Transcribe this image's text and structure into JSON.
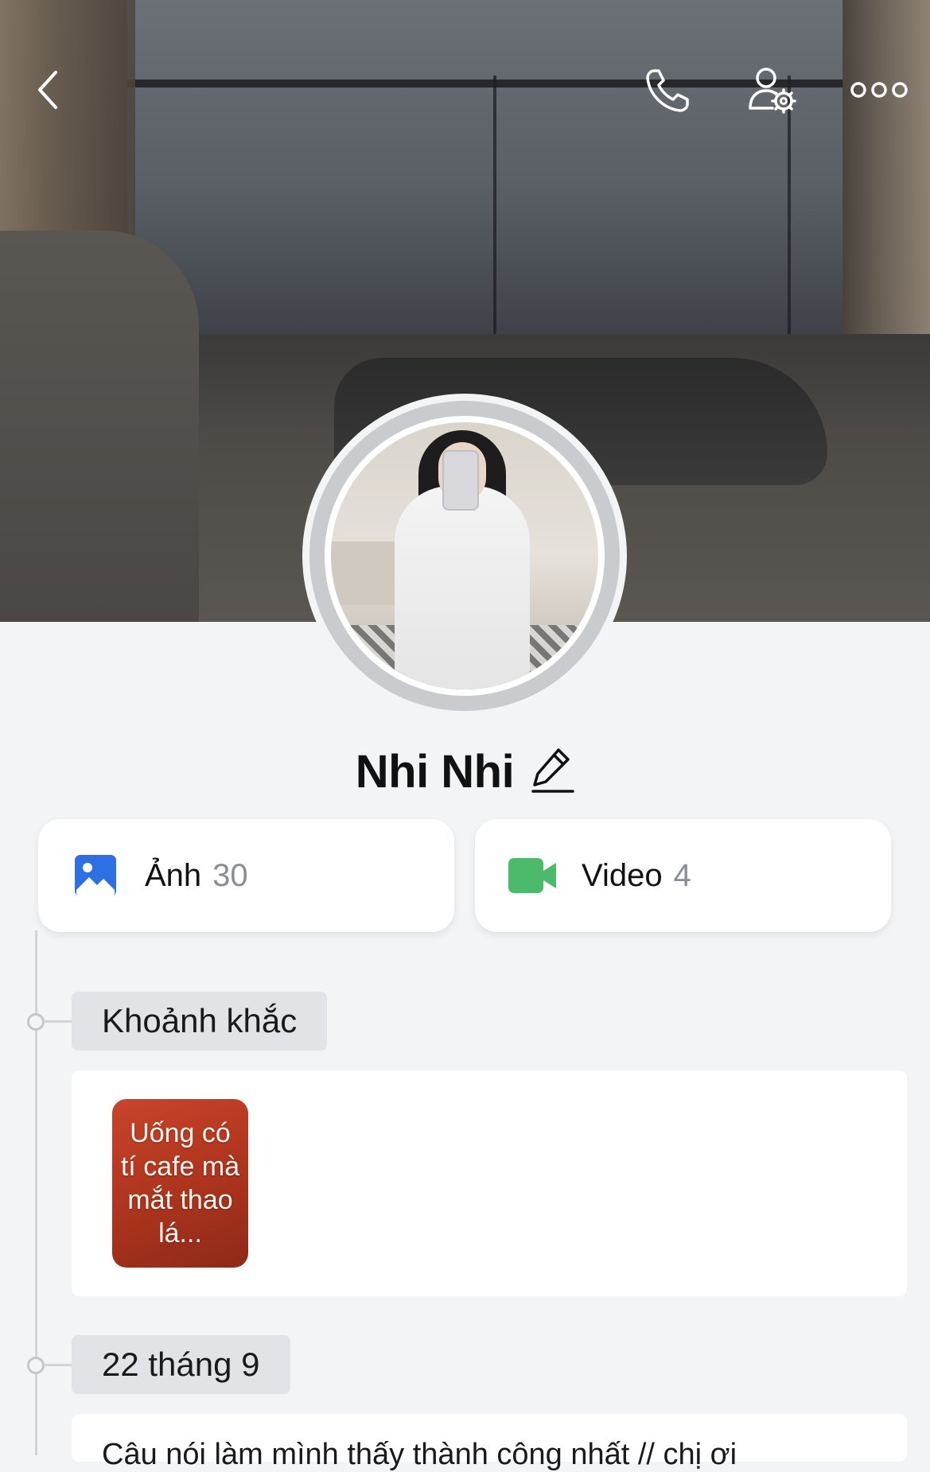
{
  "header": {
    "back_icon": "chevron-left-icon",
    "call_icon": "phone-icon",
    "settings_icon": "user-settings-icon",
    "more_icon": "more-dots-icon"
  },
  "profile": {
    "name": "Nhi Nhi",
    "edit_icon": "pencil-icon"
  },
  "media": {
    "photos": {
      "label": "Ảnh",
      "count": "30",
      "icon": "image-icon",
      "color": "#2f6fe4"
    },
    "videos": {
      "label": "Video",
      "count": "4",
      "icon": "video-camera-icon",
      "color": "#4cba6b"
    }
  },
  "timeline": {
    "sections": [
      {
        "tag": "Khoảnh khắc",
        "moment_text": "Uống có tí cafe mà mắt thao lá..."
      },
      {
        "tag": "22 tháng 9",
        "post_text": "Câu nói làm mình thấy thành công nhất // chị ơi"
      }
    ]
  }
}
